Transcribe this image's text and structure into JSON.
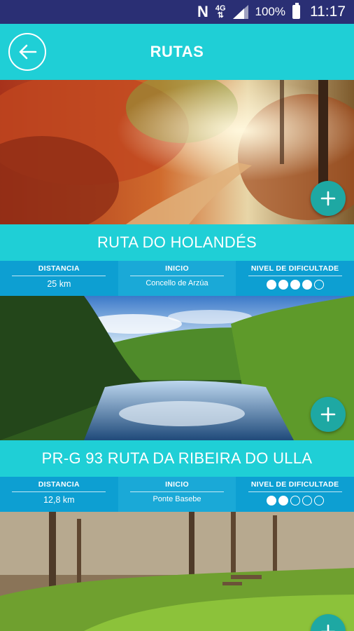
{
  "status_bar": {
    "network": "4G",
    "battery": "100%",
    "time": "11:17"
  },
  "app_bar": {
    "title": "RUTAS"
  },
  "labels": {
    "distance": "DISTANCIA",
    "start": "INICIO",
    "difficulty": "NIVEL DE DIFICULTADE"
  },
  "routes": [
    {
      "title": "RUTA DO HOLANDÉS",
      "distance": "25 km",
      "start": "Concello de Arzúa",
      "difficulty": 4,
      "difficulty_max": 5
    },
    {
      "title": "PR-G 93 RUTA DA RIBEIRA DO ULLA",
      "distance": "12,8 km",
      "start": "Ponte Basebe",
      "difficulty": 2,
      "difficulty_max": 5
    }
  ],
  "colors": {
    "status_bar": "#2a2f74",
    "app_bar": "#1fcfd6",
    "info_bar": "#0d9fd2",
    "plus_button": "#1ea8a3"
  },
  "icons": [
    "nfc-icon",
    "signal-icon",
    "battery-icon",
    "back-arrow-icon",
    "plus-icon"
  ]
}
